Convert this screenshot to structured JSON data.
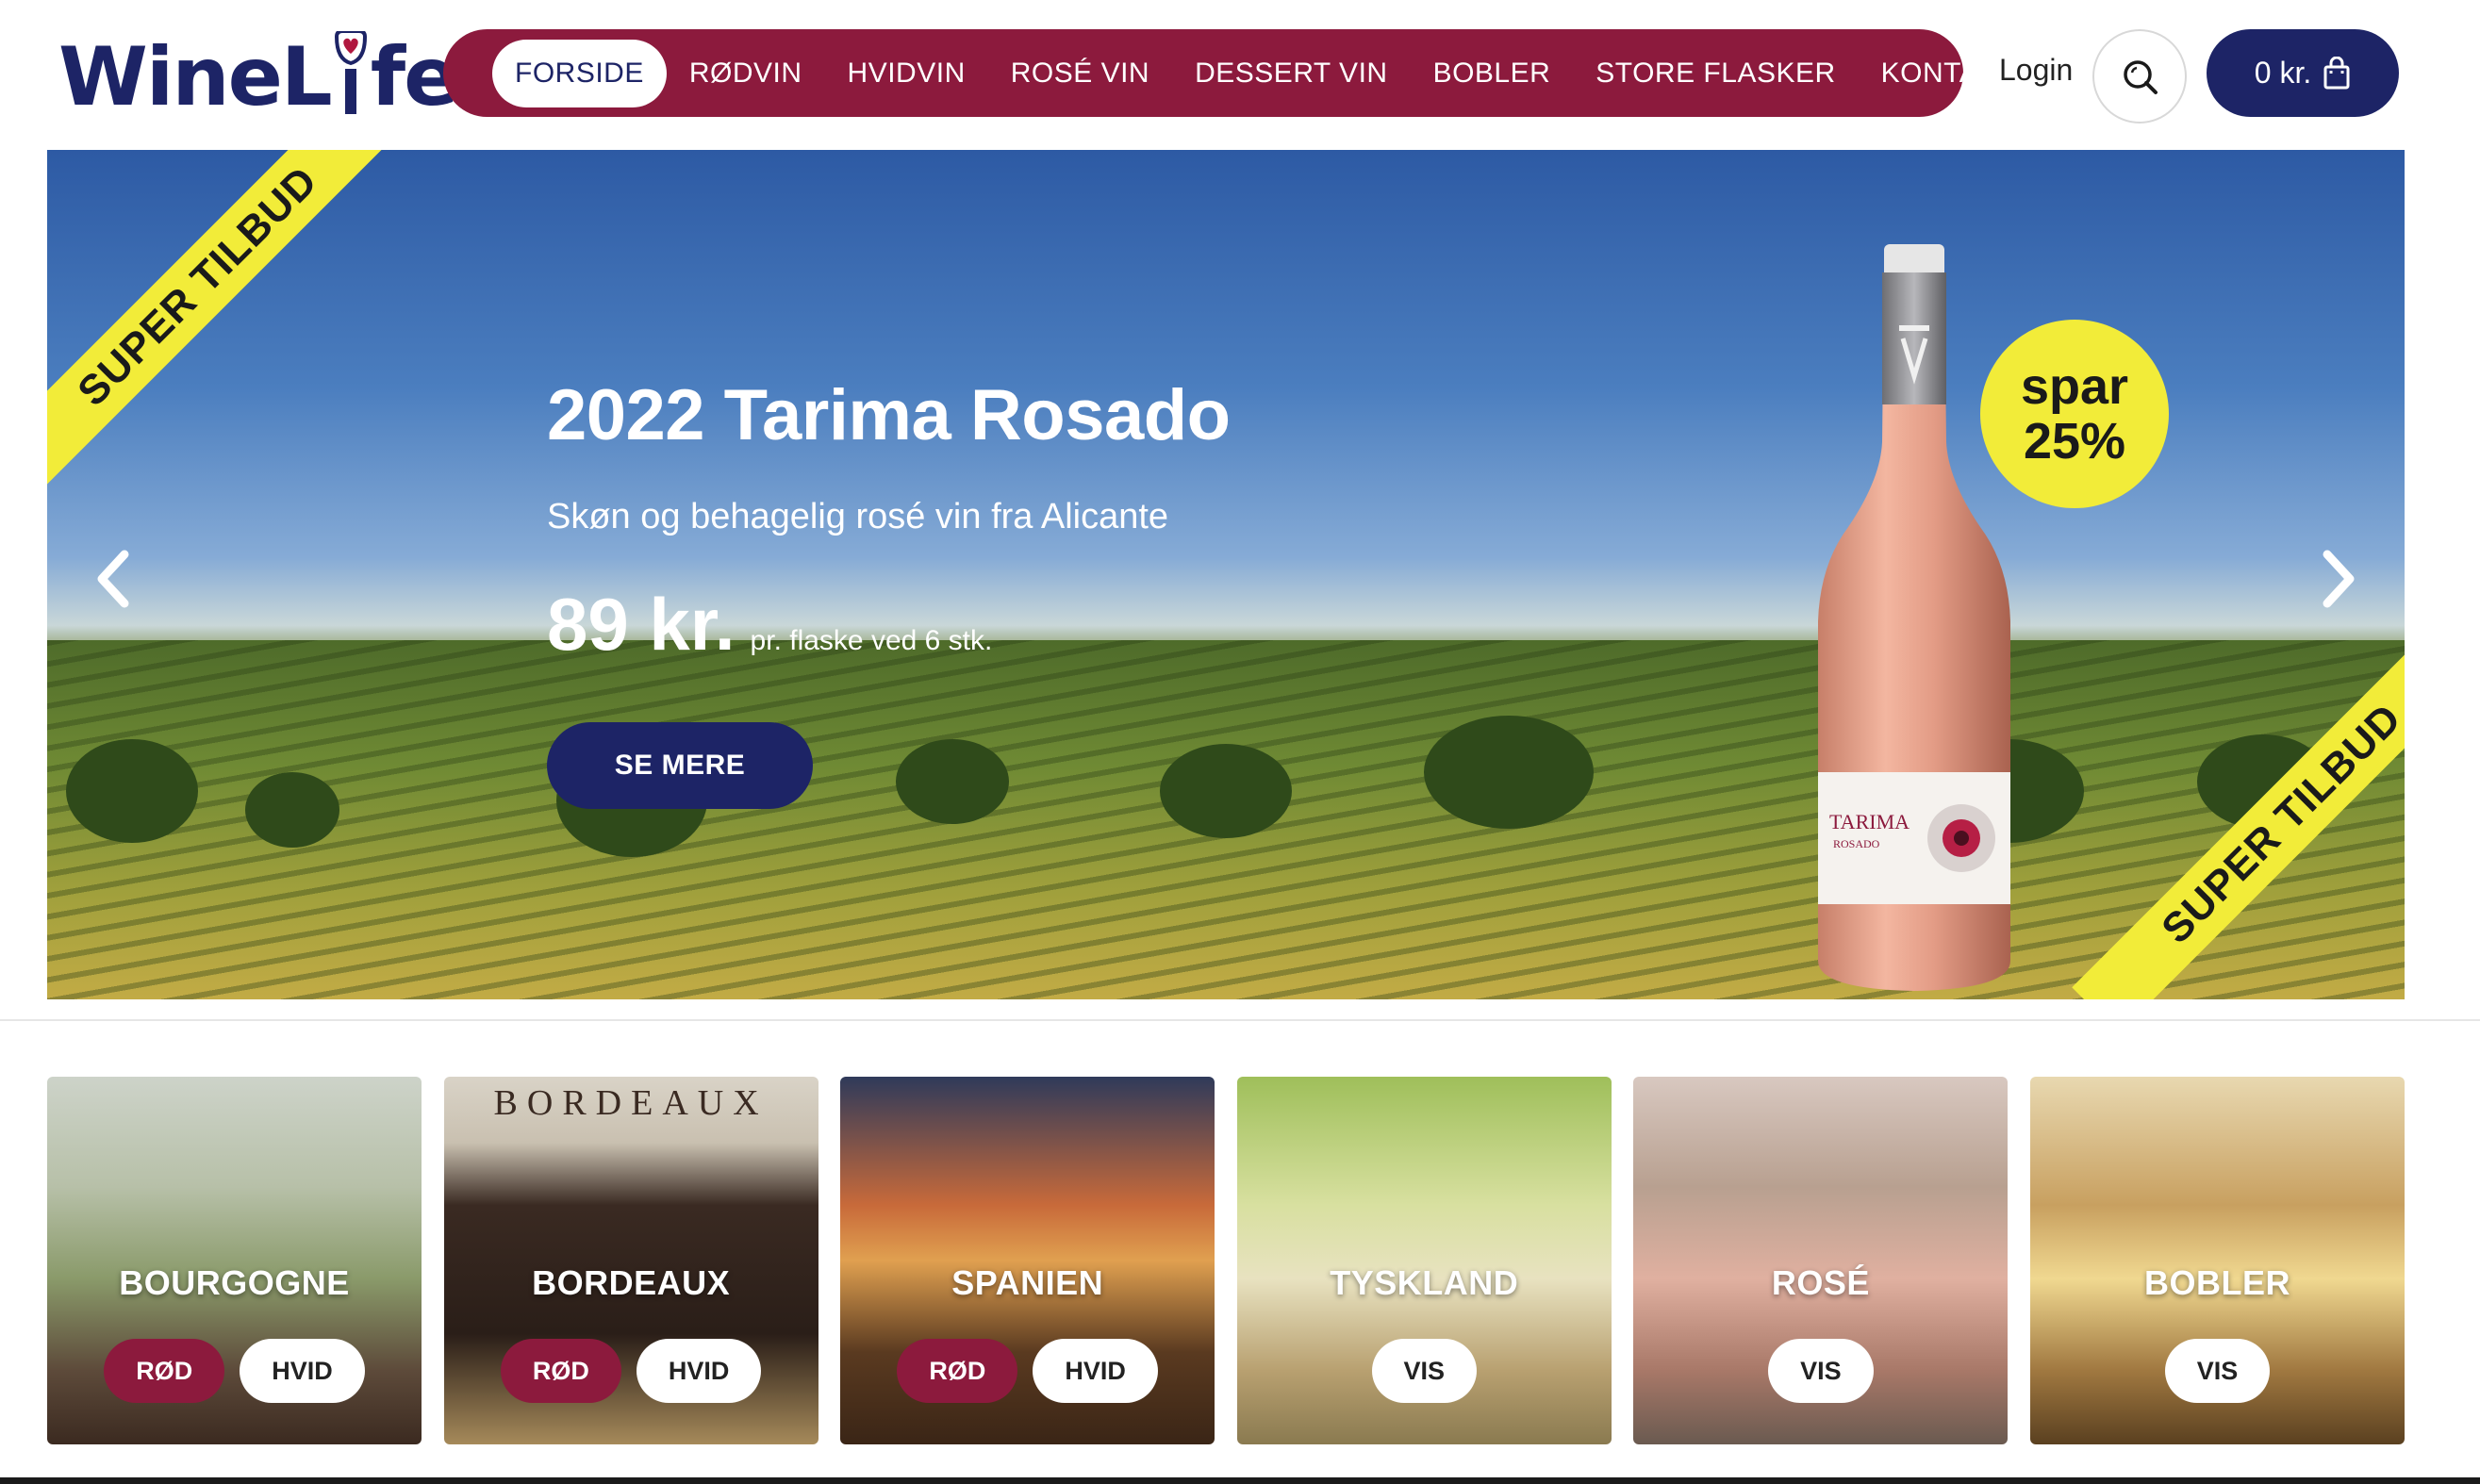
{
  "brand": {
    "logo_text_a": "WineL",
    "logo_text_b": "fe",
    "logo_color": "#1d2466",
    "accent": "#8c1a3d",
    "highlight": "#f2ec39"
  },
  "nav": {
    "items": [
      {
        "label": "FORSIDE",
        "active": true
      },
      {
        "label": "RØDVIN"
      },
      {
        "label": "HVIDVIN"
      },
      {
        "label": "ROSÉ VIN"
      },
      {
        "label": "DESSERT VIN"
      },
      {
        "label": "BOBLER"
      },
      {
        "label": "STORE FLASKER"
      },
      {
        "label": "KONTAKT"
      }
    ]
  },
  "header": {
    "login_label": "Login",
    "cart_label": "0 kr.",
    "search_icon": "search-icon",
    "cart_icon": "shopping-bag-icon"
  },
  "hero": {
    "ribbon_text": "SUPER TILBUD",
    "title": "2022 Tarima Rosado",
    "subtitle": "Skøn og behagelig rosé vin fra Alicante",
    "price": "89 kr.",
    "price_note": "pr. flaske ved 6 stk.",
    "button_label": "SE MERE",
    "badge_line1": "spar",
    "badge_line2": "25%",
    "bottle_label": "TARIMA",
    "bottle_sublabel": "ROSADO"
  },
  "categories": [
    {
      "title": "BOURGOGNE",
      "buttons": [
        {
          "label": "RØD",
          "style": "red"
        },
        {
          "label": "HVID",
          "style": "white"
        }
      ]
    },
    {
      "title": "BORDEAUX",
      "banner": "BORDEAUX",
      "buttons": [
        {
          "label": "RØD",
          "style": "red"
        },
        {
          "label": "HVID",
          "style": "white"
        }
      ]
    },
    {
      "title": "SPANIEN",
      "buttons": [
        {
          "label": "RØD",
          "style": "red"
        },
        {
          "label": "HVID",
          "style": "white"
        }
      ]
    },
    {
      "title": "TYSKLAND",
      "buttons": [
        {
          "label": "VIS",
          "style": "white"
        }
      ]
    },
    {
      "title": "ROSÉ",
      "buttons": [
        {
          "label": "VIS",
          "style": "white"
        }
      ]
    },
    {
      "title": "BOBLER",
      "buttons": [
        {
          "label": "VIS",
          "style": "white"
        }
      ]
    }
  ]
}
